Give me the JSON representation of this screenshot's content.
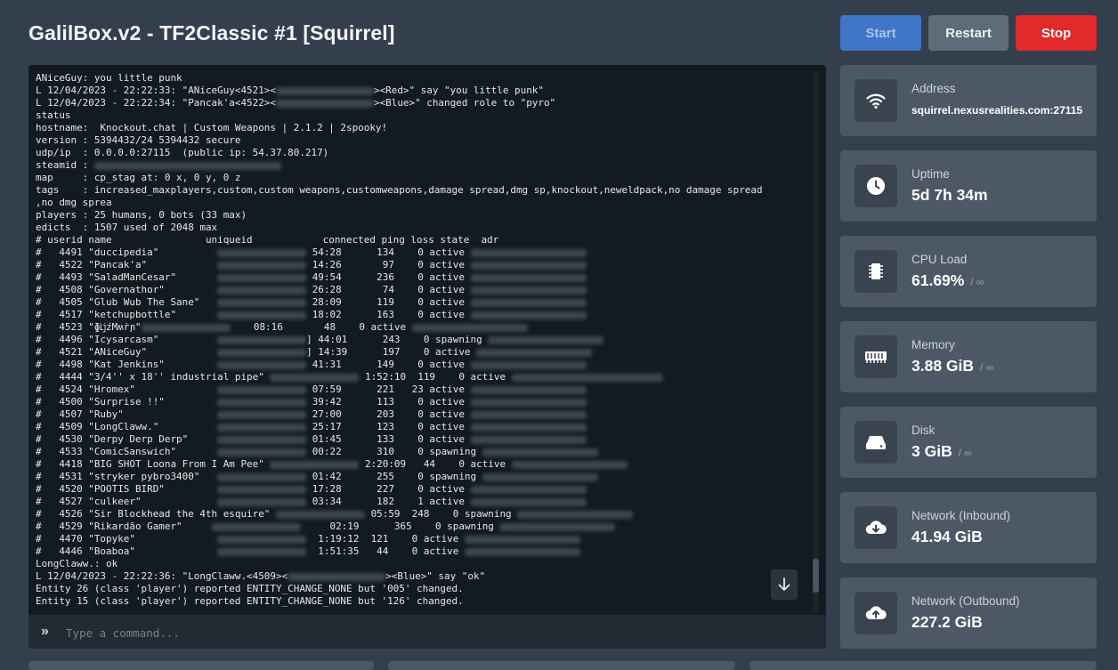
{
  "header": {
    "title": "GalilBox.v2 - TF2Classic #1 [Squirrel]",
    "buttons": {
      "start": "Start",
      "restart": "Restart",
      "stop": "Stop"
    }
  },
  "console": {
    "lines": [
      "ANiceGuy: you little punk",
      "L 12/04/2023 - 22:22:33: \"ANiceGuy<4521><",
      "L 12/04/2023 - 22:22:34: \"Pancak'a<4522><",
      "status",
      "hostname:  Knockout.chat | Custom Weapons | 2.1.2 | 2spooky!",
      "version : 5394432/24 5394432 secure",
      "udp/ip  : 0.0.0.0:27115  (public ip: 54.37.80.217)",
      "steamid : ",
      "map     : cp_stag at: 0 x, 0 y, 0 z",
      "tags    : increased_maxplayers,custom,custom weapons,customweapons,damage spread,dmg sp,knockout,neweldpack,no damage spread",
      ",no dmg sprea",
      "players : 25 humans, 0 bots (33 max)",
      "edicts  : 1507 used of 2048 max",
      "# userid name                uniqueid            connected ping loss state  adr",
      "#   4491 \"duccipedia\"          ",
      "#   4522 \"Pancak'a\"            ",
      "#   4493 \"SaladManCesar\"       ",
      "#   4508 \"Governathor\"         ",
      "#   4505 \"Glub Wub The Sane\"   ",
      "#   4517 \"ketchupbottle\"       ",
      "#   4523 \"ɸǈźΜʍṙɲ\"",
      "#   4496 \"Icysarcasm\"          ",
      "#   4521 \"ANiceGuy\"            ",
      "#   4498 \"Kat Jenkins\"         ",
      "#   4444 \"3/4'' x 18'' industrial pipe\" ",
      "#   4524 \"Hromex\"              ",
      "#   4500 \"Surprise !!\"         ",
      "#   4507 \"Ruby\"                ",
      "#   4509 \"LongClaww.\"          ",
      "#   4530 \"Derpy Derp Derp\"     ",
      "#   4533 \"ComicSanswich\"       ",
      "#   4418 \"BIG SHOT Loona From I Am Pee\" ",
      "#   4531 \"stryker pybro3400\"   ",
      "#   4520 \"POOTIS BIRD\"         ",
      "#   4527 \"culkeer\"             ",
      "#   4526 \"Sir Blockhead the 4th esquire\" ",
      "#   4529 \"Rikardão Gamer\"     ",
      "#   4470 \"Topyke\"              ",
      "#   4446 \"Boaboa\"              ",
      "LongClaww.: ok",
      "L 12/04/2023 - 22:22:36: \"LongClaww.<4509><",
      "Entity 26 (class 'player') reported ENTITY_CHANGE_NONE but '005' changed.",
      "Entity 15 (class 'player') reported ENTITY_CHANGE_NONE but '126' changed."
    ],
    "line_tails": [
      "",
      "><Red>\" say \"you little punk\"",
      "><Blue>\" changed role to \"pyro\"",
      "",
      "",
      "",
      "",
      "",
      "",
      "",
      "",
      "",
      "",
      "",
      " 54:28      134    0 active ",
      " 14:26       97    0 active ",
      " 49:54      236    0 active ",
      " 26:28       74    0 active ",
      " 28:09      119    0 active ",
      " 18:02      163    0 active ",
      "    08:16       48    0 active ",
      "] 44:01      243    0 spawning ",
      "] 14:39      197    0 active ",
      " 41:31      149    0 active ",
      " 1:52:10  119    0 active ",
      " 07:59      221   23 active ",
      " 39:42      113    0 active ",
      " 27:00      203    0 active ",
      " 25:17      123    0 active ",
      " 01:45      133    0 active ",
      " 00:22      310    0 spawning ",
      " 2:20:09   44    0 active ",
      " 01:42      255    0 spawning ",
      " 17:28      227    0 active ",
      " 03:34      182    1 active ",
      " 05:59  248    0 spawning ",
      "     02:19      365    0 spawning ",
      "  1:19:12  121    0 active ",
      "  1:51:35   44    0 active ",
      "",
      "><Blue>\" say \"ok\"",
      "",
      ""
    ],
    "command_placeholder": "Type a command..."
  },
  "stats": [
    {
      "label": "Address",
      "value": "squirrel.nexusrealities.com:27115",
      "suffix": "",
      "icon": "wifi-icon"
    },
    {
      "label": "Uptime",
      "value": "5d 7h 34m",
      "suffix": "",
      "icon": "clock-icon"
    },
    {
      "label": "CPU Load",
      "value": "61.69%",
      "suffix": "/ ∞",
      "icon": "cpu-chip-icon"
    },
    {
      "label": "Memory",
      "value": "3.88 GiB",
      "suffix": "/ ∞",
      "icon": "memory-icon"
    },
    {
      "label": "Disk",
      "value": "3 GiB",
      "suffix": "/ ∞",
      "icon": "hard-drive-icon"
    },
    {
      "label": "Network (Inbound)",
      "value": "41.94 GiB",
      "suffix": "",
      "icon": "cloud-download-icon"
    },
    {
      "label": "Network (Outbound)",
      "value": "227.2 GiB",
      "suffix": "",
      "icon": "cloud-upload-icon"
    }
  ],
  "colors": {
    "background": "#333f4d",
    "console_bg": "#131a20",
    "card_bg": "#4c5866",
    "start": "#3f76c8",
    "restart": "#5e6b78",
    "stop": "#e22a2a"
  }
}
